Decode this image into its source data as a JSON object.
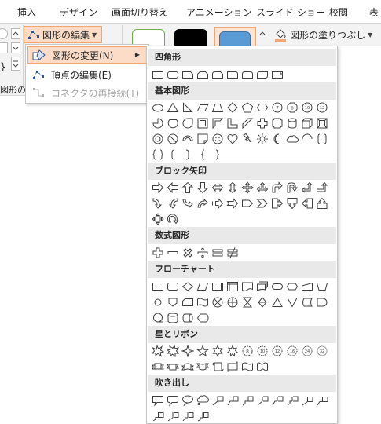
{
  "ribbon_tabs": [
    "挿入",
    "デザイン",
    "画面切り替え",
    "アニメーション",
    "スライド ショー",
    "校閲",
    "表"
  ],
  "ribbon": {
    "edit_shape_button": "図形の編集",
    "shape_fill_button": "図形の塗りつぶし",
    "left_group_label": "図形の挿"
  },
  "edit_submenu": {
    "items": [
      {
        "label": "図形の変更(N)",
        "icon": "change-shape-icon",
        "state": "active",
        "has_submenu": true
      },
      {
        "label": "頂点の編集(E)",
        "icon": "edit-points-icon",
        "state": "normal"
      },
      {
        "label": "コネクタの再接続(T)",
        "icon": "reroute-connector-icon",
        "state": "disabled"
      }
    ]
  },
  "gallery": {
    "categories": [
      "四角形",
      "基本図形",
      "ブロック矢印",
      "数式図形",
      "フローチャート",
      "星とリボン",
      "吹き出し"
    ],
    "rows": [
      {
        "category_index": 0,
        "shapes": [
          "rect",
          "round-rect",
          "snip-rect",
          "snip-rect2",
          "snip-round",
          "round-single",
          "round-same",
          "round-diag",
          "rect-fold"
        ]
      },
      {
        "category_index": 1,
        "shapes": [
          "oval",
          "triangle",
          "right-triangle",
          "parallelogram",
          "trapezoid",
          "diamond",
          "pentagon",
          "hexagon",
          "heptagon",
          "octagon",
          "decagon",
          "dodecagon"
        ]
      },
      {
        "category_index": 1,
        "shapes": [
          "pie",
          "chord",
          "teardrop",
          "frame",
          "half-frame",
          "l-shape",
          "diagonal-stripe",
          "plus",
          "plaque",
          "can",
          "cube",
          "bevel"
        ]
      },
      {
        "category_index": 1,
        "shapes": [
          "donut",
          "no-symbol",
          "block-arc",
          "folded-corner",
          "smiley",
          "heart",
          "lightning",
          "sun",
          "moon",
          "cloud",
          "arc",
          "double-bracket"
        ]
      },
      {
        "category_index": 1,
        "shapes": [
          "double-brace",
          "left-bracket",
          "right-bracket",
          "left-brace",
          "right-brace"
        ]
      },
      {
        "category_index": 2,
        "shapes": [
          "right-arrow",
          "left-arrow",
          "up-arrow",
          "down-arrow",
          "left-right-arrow",
          "up-down-arrow",
          "quad-arrow",
          "left-right-up-arrow",
          "bent-arrow",
          "u-turn-arrow",
          "left-up-arrow",
          "bent-up-arrow"
        ]
      },
      {
        "category_index": 2,
        "shapes": [
          "curved-right",
          "curved-left",
          "curved-up",
          "curved-down",
          "striped-right",
          "notched-right",
          "pentagon-arrow",
          "chevron",
          "right-callout",
          "down-callout",
          "left-callout",
          "up-callout"
        ]
      },
      {
        "category_index": 2,
        "shapes": [
          "quad-callout",
          "circular-arrow"
        ]
      },
      {
        "category_index": 3,
        "shapes": [
          "math-plus",
          "math-minus",
          "math-multiply",
          "math-divide",
          "math-equal",
          "math-not-equal"
        ]
      },
      {
        "category_index": 4,
        "shapes": [
          "process",
          "alternate-process",
          "decision",
          "data",
          "predefined",
          "internal-storage",
          "document",
          "multidocument",
          "terminator",
          "preparation",
          "manual-input",
          "manual-operation"
        ]
      },
      {
        "category_index": 4,
        "shapes": [
          "connector",
          "offpage",
          "card",
          "punched-tape",
          "summing",
          "or",
          "collate",
          "sort",
          "extract",
          "merge",
          "stored-data",
          "delay"
        ]
      },
      {
        "category_index": 4,
        "shapes": [
          "sequential",
          "magnetic-disk",
          "direct-access",
          "display"
        ]
      },
      {
        "category_index": 5,
        "shapes": [
          "explosion1",
          "explosion2",
          "star4",
          "star5",
          "star6",
          "star7",
          "star8",
          "star10",
          "star12",
          "star16",
          "star24",
          "star32"
        ]
      },
      {
        "category_index": 5,
        "shapes": [
          "ribbon-up",
          "ribbon-down",
          "curved-ribbon-up",
          "curved-ribbon-down",
          "vertical-scroll",
          "horizontal-scroll",
          "wave",
          "double-wave"
        ]
      },
      {
        "category_index": 6,
        "shapes": [
          "rect-callout",
          "round-callout",
          "oval-callout",
          "cloud-callout",
          "line-callout1",
          "line-callout2",
          "line-callout3",
          "accent-callout1",
          "accent-callout2",
          "accent-callout3",
          "border-callout1",
          "border-callout2"
        ]
      },
      {
        "category_index": 6,
        "shapes": [
          "border-callout3",
          "accent-border-callout1",
          "accent-border-callout2",
          "accent-border-callout3"
        ]
      }
    ]
  },
  "colors": {
    "accent_highlight": "#fcdcc6",
    "accent_border": "#f0a773",
    "category_bg": "#e9e9e9",
    "style_thumb_blue": "#5b9bd5"
  }
}
